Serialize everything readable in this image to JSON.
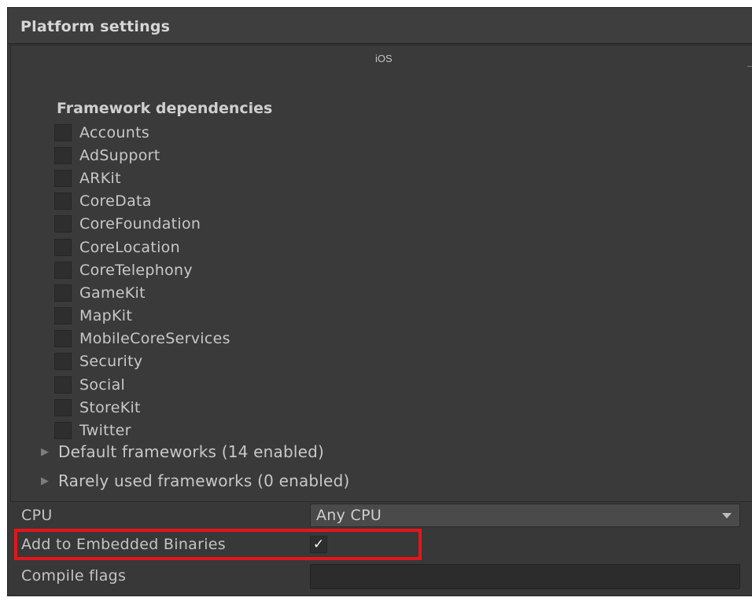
{
  "panel": {
    "title": "Platform settings",
    "platform_tab": "iOS"
  },
  "frameworks": {
    "heading": "Framework dependencies",
    "items": [
      {
        "label": "Accounts",
        "checked": false
      },
      {
        "label": "AdSupport",
        "checked": false
      },
      {
        "label": "ARKit",
        "checked": false
      },
      {
        "label": "CoreData",
        "checked": false
      },
      {
        "label": "CoreFoundation",
        "checked": false
      },
      {
        "label": "CoreLocation",
        "checked": false
      },
      {
        "label": "CoreTelephony",
        "checked": false
      },
      {
        "label": "GameKit",
        "checked": false
      },
      {
        "label": "MapKit",
        "checked": false
      },
      {
        "label": "MobileCoreServices",
        "checked": false
      },
      {
        "label": "Security",
        "checked": false
      },
      {
        "label": "Social",
        "checked": false
      },
      {
        "label": "StoreKit",
        "checked": false
      },
      {
        "label": "Twitter",
        "checked": false
      }
    ],
    "default_foldout": "Default frameworks (14 enabled)",
    "rare_foldout": "Rarely used frameworks (0 enabled)"
  },
  "cpu": {
    "label": "CPU",
    "value": "Any CPU"
  },
  "embedded": {
    "label": "Add to Embedded Binaries",
    "checked": true,
    "checkmark": "✓"
  },
  "compile": {
    "label": "Compile flags",
    "value": ""
  },
  "icons": {
    "foldout": "triangle-right-icon",
    "dropdown": "chevron-down-icon",
    "check": "checkmark-icon"
  },
  "colors": {
    "panel_bg": "#383838",
    "annotation": "#e3161b"
  }
}
